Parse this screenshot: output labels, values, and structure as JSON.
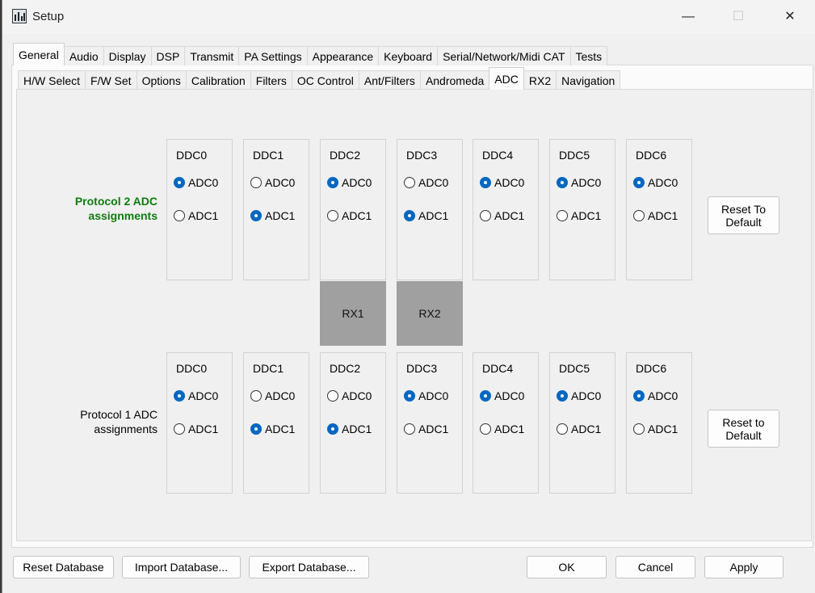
{
  "window": {
    "title": "Setup",
    "minimize": "—",
    "maximize": "☐",
    "close": "✕"
  },
  "tabs_top": [
    "General",
    "Audio",
    "Display",
    "DSP",
    "Transmit",
    "PA Settings",
    "Appearance",
    "Keyboard",
    "Serial/Network/Midi CAT",
    "Tests"
  ],
  "tabs_top_active": "General",
  "tabs_sub": [
    "H/W Select",
    "F/W Set",
    "Options",
    "Calibration",
    "Filters",
    "OC Control",
    "Ant/Filters",
    "Andromeda",
    "ADC",
    "RX2",
    "Navigation"
  ],
  "tabs_sub_active": "ADC",
  "protocol2": {
    "label_line1": "Protocol 2 ADC",
    "label_line2": "assignments",
    "reset_line1": "Reset To",
    "reset_line2": "Default",
    "groups": [
      {
        "name": "DDC0",
        "adc0": "ADC0",
        "adc1": "ADC1",
        "selected": "ADC0"
      },
      {
        "name": "DDC1",
        "adc0": "ADC0",
        "adc1": "ADC1",
        "selected": "ADC1"
      },
      {
        "name": "DDC2",
        "adc0": "ADC0",
        "adc1": "ADC1",
        "selected": "ADC0"
      },
      {
        "name": "DDC3",
        "adc0": "ADC0",
        "adc1": "ADC1",
        "selected": "ADC1"
      },
      {
        "name": "DDC4",
        "adc0": "ADC0",
        "adc1": "ADC1",
        "selected": "ADC0"
      },
      {
        "name": "DDC5",
        "adc0": "ADC0",
        "adc1": "ADC1",
        "selected": "ADC0"
      },
      {
        "name": "DDC6",
        "adc0": "ADC0",
        "adc1": "ADC1",
        "selected": "ADC0"
      }
    ]
  },
  "rx_labels": {
    "rx1": "RX1",
    "rx2": "RX2"
  },
  "protocol1": {
    "label_line1": "Protocol 1 ADC",
    "label_line2": "assignments",
    "reset_line1": "Reset to",
    "reset_line2": "Default",
    "groups": [
      {
        "name": "DDC0",
        "adc0": "ADC0",
        "adc1": "ADC1",
        "selected": "ADC0"
      },
      {
        "name": "DDC1",
        "adc0": "ADC0",
        "adc1": "ADC1",
        "selected": "ADC1"
      },
      {
        "name": "DDC2",
        "adc0": "ADC0",
        "adc1": "ADC1",
        "selected": "ADC1"
      },
      {
        "name": "DDC3",
        "adc0": "ADC0",
        "adc1": "ADC1",
        "selected": "ADC0"
      },
      {
        "name": "DDC4",
        "adc0": "ADC0",
        "adc1": "ADC1",
        "selected": "ADC0"
      },
      {
        "name": "DDC5",
        "adc0": "ADC0",
        "adc1": "ADC1",
        "selected": "ADC0"
      },
      {
        "name": "DDC6",
        "adc0": "ADC0",
        "adc1": "ADC1",
        "selected": "ADC0"
      }
    ]
  },
  "footer": {
    "reset_db": "Reset Database",
    "import_db": "Import Database...",
    "export_db": "Export Database...",
    "ok": "OK",
    "cancel": "Cancel",
    "apply": "Apply"
  },
  "colors": {
    "accent": "#0067c0",
    "protocol2_label": "#107c10",
    "rx_box": "#a0a0a0"
  }
}
